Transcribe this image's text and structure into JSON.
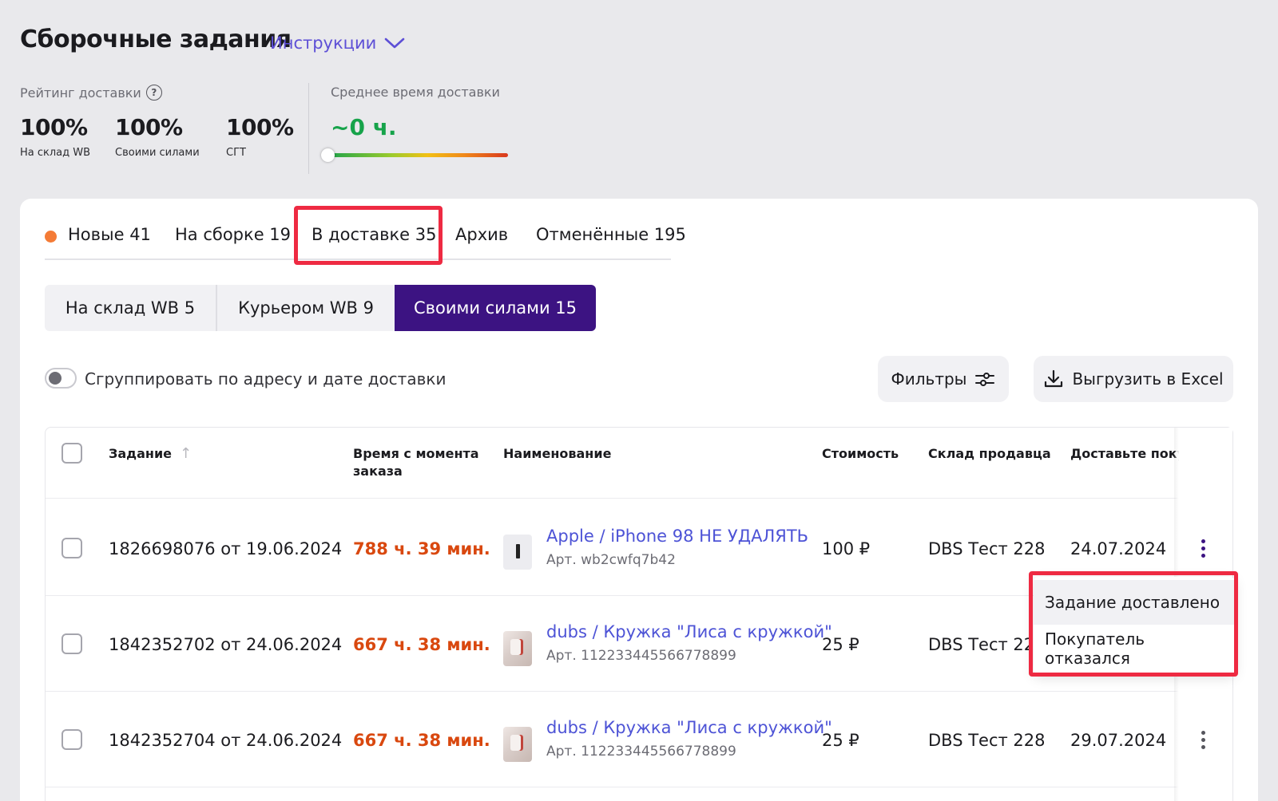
{
  "header": {
    "title": "Сборочные задания",
    "instructions_label": "Инструкции"
  },
  "rating": {
    "label": "Рейтинг доставки",
    "metrics": [
      {
        "value": "100%",
        "caption": "На склад WB"
      },
      {
        "value": "100%",
        "caption": "Своими силами"
      },
      {
        "value": "100%",
        "caption": "СГТ"
      }
    ]
  },
  "avg_delivery": {
    "label": "Среднее время доставки",
    "value": "~0 ч.",
    "level_fraction": 0.0
  },
  "tabs": [
    {
      "label": "Новые 41",
      "has_dot": true
    },
    {
      "label": "На сборке 19"
    },
    {
      "label": "В доставке 35",
      "active": true
    },
    {
      "label": "Архив"
    },
    {
      "label": "Отменённые 195"
    }
  ],
  "segments": [
    {
      "label": "На склад WB 5"
    },
    {
      "label": "Курьером WB 9"
    },
    {
      "label": "Своими силами 15",
      "active": true
    }
  ],
  "group_toggle": {
    "label": "Сгруппировать по адресу и дате доставки",
    "on": false
  },
  "buttons": {
    "filters": "Фильтры",
    "export": "Выгрузить в Excel"
  },
  "table": {
    "headers": {
      "task": "Задание",
      "time_line1": "Время с момента",
      "time_line2": "заказа",
      "name": "Наименование",
      "price": "Стоимость",
      "warehouse": "Склад продавца",
      "deliver": "Доставьте поку"
    },
    "rows": [
      {
        "task": "1826698076 от 19.06.2024",
        "time": "788 ч. 39 мин.",
        "name": "Apple / iPhone 98 НЕ УДАЛЯТЬ",
        "article": "Арт. wb2cwfq7b42",
        "price": "100 ₽",
        "warehouse": "DBS Тест 228",
        "date": "24.07.2024",
        "thumb": "phone-icon"
      },
      {
        "task": "1842352702 от 24.06.2024",
        "time": "667 ч. 38 мин.",
        "name": "dubs / Кружка \"Лиса с кружкой\"",
        "article": "Арт. 112233445566778899",
        "price": "25 ₽",
        "warehouse": "DBS Тест 228",
        "date": "",
        "thumb": "mug-icon"
      },
      {
        "task": "1842352704 от 24.06.2024",
        "time": "667 ч. 38 мин.",
        "name": "dubs / Кружка \"Лиса с кружкой\"",
        "article": "Арт. 112233445566778899",
        "price": "25 ₽",
        "warehouse": "DBS Тест 228",
        "date": "29.07.2024",
        "thumb": "mug-icon"
      }
    ]
  },
  "context_menu": {
    "items": [
      "Задание доставлено",
      "Покупатель отказался"
    ]
  },
  "colors": {
    "accent": "#3c1382",
    "link": "#4d53d6",
    "time_warning": "#d9480f",
    "highlight": "#ee2a42",
    "new_dot": "#f47b36",
    "avg_ok": "#16a34a"
  }
}
